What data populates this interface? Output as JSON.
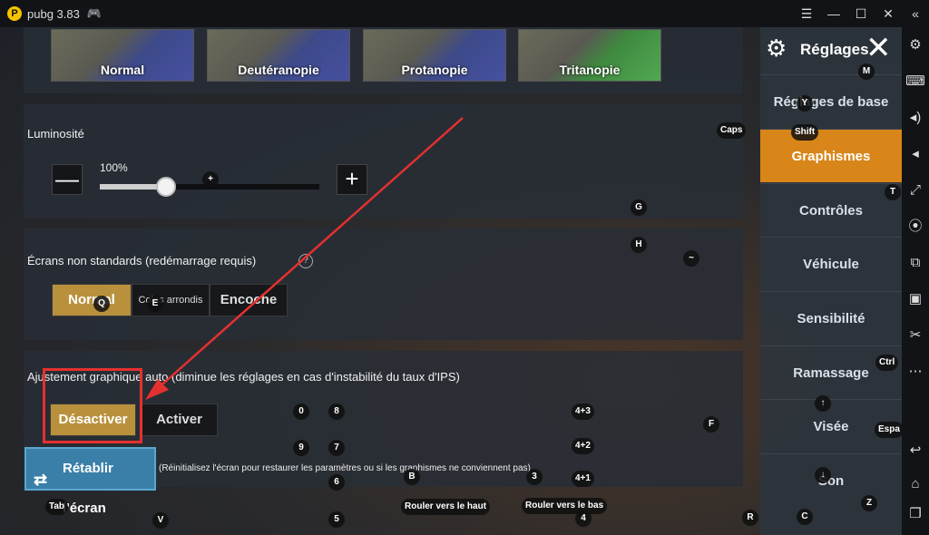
{
  "titlebar": {
    "title": "pubg 3.83",
    "logo": "P",
    "controls": [
      "☰",
      "—",
      "☐",
      "✕",
      "«"
    ]
  },
  "color_modes": [
    "Normal",
    "Deutéranopie",
    "Protanopie",
    "Tritanopie"
  ],
  "brightness": {
    "title": "Luminosité",
    "value_label": "100%",
    "minus": "—",
    "plus": "+",
    "level": 0.3
  },
  "screens": {
    "title": "Écrans non standards (redémarrage requis)",
    "help": "?",
    "options": [
      "Normal",
      "Coins arrondis",
      "Encoche"
    ],
    "selected": "Normal"
  },
  "auto_adjust": {
    "title": "Ajustement graphique auto (diminue les réglages en cas d'instabilité du taux d'IPS)",
    "options": [
      "Désactiver",
      "Activer"
    ],
    "selected": "Désactiver"
  },
  "reset": {
    "label": "Rétablir l'écran",
    "hint": "(Réinitialisez l'écran pour restaurer les paramètres ou si les graphismes ne conviennent pas)"
  },
  "nav": {
    "title": "Réglages",
    "items": [
      "Réglages de base",
      "Graphismes",
      "Contrôles",
      "Véhicule",
      "Sensibilité",
      "Ramassage",
      "Visée",
      "Son"
    ],
    "active": "Graphismes"
  },
  "keys": {
    "m": "M",
    "caps": "Caps",
    "shift": "Shift",
    "t": "T",
    "g": "G",
    "h": "H",
    "tilde": "~",
    "q": "Q",
    "e": "E",
    "plus": "+",
    "k0": "0",
    "k8": "8",
    "k9": "9",
    "k7": "7",
    "k6": "6",
    "k5": "5",
    "k43": "4+3",
    "k42": "4+2",
    "k41": "4+1",
    "k4": "4",
    "k3": "3",
    "b": "B",
    "f": "F",
    "ctrl": "Ctrl",
    "up": "↑",
    "down": "↓",
    "espace": "Espa",
    "z": "Z",
    "c": "C",
    "r": "R",
    "v": "V",
    "tab": "Tab",
    "y": "Y",
    "scroll_up": "Rouler vers le haut",
    "scroll_down": "Rouler vers le bas"
  },
  "accent_colors": {
    "active_nav": "#d8861a",
    "selected_option": "#b9913d",
    "annotation": "#e53030",
    "reset_button": "#3a7fa8"
  }
}
